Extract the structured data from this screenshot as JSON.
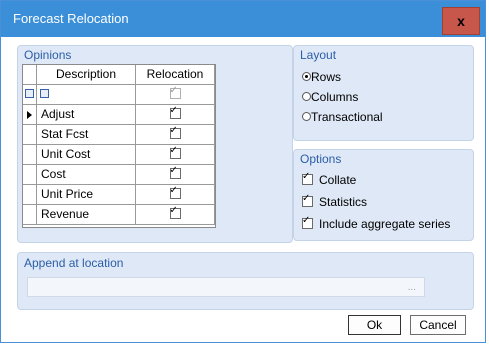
{
  "window": {
    "title": "Forecast Relocation",
    "close_label": "x"
  },
  "opinions": {
    "label": "Opinions",
    "columns": {
      "description": "Description",
      "relocation": "Relocation"
    },
    "header_all_checked": true,
    "rows": [
      {
        "description": "Adjust",
        "checked": true,
        "current": true
      },
      {
        "description": "Stat Fcst",
        "checked": true,
        "current": false
      },
      {
        "description": "Unit Cost",
        "checked": true,
        "current": false
      },
      {
        "description": "Cost",
        "checked": true,
        "current": false
      },
      {
        "description": "Unit Price",
        "checked": true,
        "current": false
      },
      {
        "description": "Revenue",
        "checked": true,
        "current": false
      }
    ]
  },
  "layout": {
    "label": "Layout",
    "options": [
      {
        "label": "Rows",
        "selected": true
      },
      {
        "label": "Columns",
        "selected": false
      },
      {
        "label": "Transactional",
        "selected": false
      }
    ]
  },
  "options": {
    "label": "Options",
    "items": [
      {
        "label": "Collate",
        "checked": true
      },
      {
        "label": "Statistics",
        "checked": true
      },
      {
        "label": "Include aggregate series",
        "checked": true
      }
    ]
  },
  "append": {
    "label": "Append at location",
    "value": "",
    "browse_label": "..."
  },
  "buttons": {
    "ok": "Ok",
    "cancel": "Cancel"
  }
}
